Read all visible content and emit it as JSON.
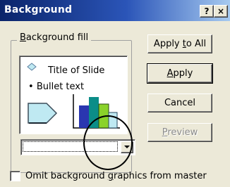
{
  "window": {
    "title": "Background",
    "help_label": "?",
    "close_label": "×"
  },
  "background_fill": {
    "legend": "Background fill",
    "preview": {
      "slide_title": "Title of Slide",
      "bullet": "•",
      "bullet_text": "Bullet text"
    },
    "color_dropdown": {
      "selected_value": ""
    }
  },
  "buttons": {
    "apply_to_all": "Apply to All",
    "apply": "Apply",
    "cancel": "Cancel",
    "preview": "Preview"
  },
  "omit_graphics": {
    "label": "Omit background graphics from master",
    "checked": false
  },
  "colors": {
    "title_bar_start": "#0a246a",
    "title_bar_end": "#a6caf0",
    "dialog_bg": "#ece9d8",
    "arrow_shape": "#bfe9f2",
    "bar_blue": "#2a36b0",
    "bar_teal": "#0b8d88",
    "bar_green": "#8ad22a",
    "bar_cyan": "#bfe9f2"
  }
}
